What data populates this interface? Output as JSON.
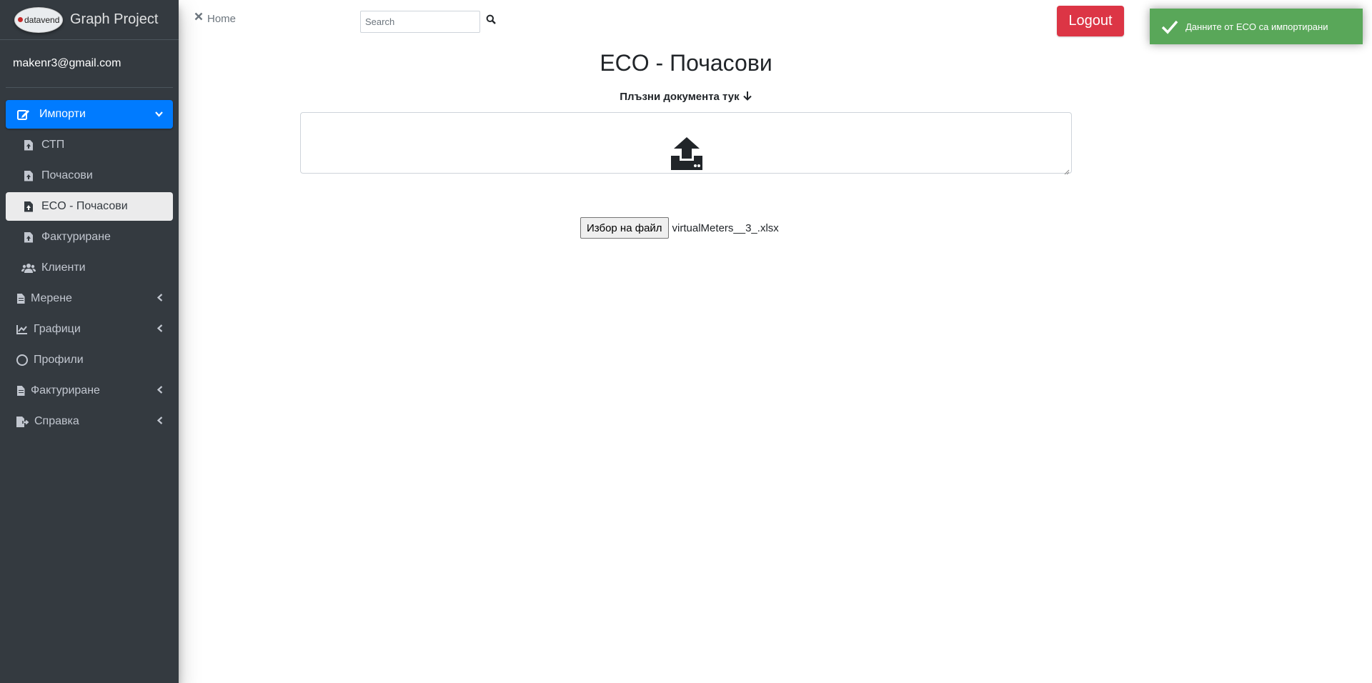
{
  "brand": {
    "logo_text": "datavend",
    "title": "Graph Project"
  },
  "user": {
    "email": "makenr3@gmail.com"
  },
  "sidebar": {
    "items": [
      {
        "label": "Импорти",
        "icon": "edit-icon",
        "state": "active",
        "expanded": true
      },
      {
        "label": "СТП",
        "icon": "file-upload-icon",
        "sub": true
      },
      {
        "label": "Почасови",
        "icon": "file-upload-icon",
        "sub": true
      },
      {
        "label": "ECO - Почасови",
        "icon": "file-upload-icon",
        "sub": true,
        "state": "selected"
      },
      {
        "label": "Фактуриране",
        "icon": "file-upload-icon",
        "sub": true
      },
      {
        "label": "Клиенти",
        "icon": "users-icon"
      },
      {
        "label": "Мерене",
        "icon": "file-text-icon",
        "has_children": true
      },
      {
        "label": "Графици",
        "icon": "chart-line-icon",
        "has_children": true
      },
      {
        "label": "Профили",
        "icon": "circle-icon"
      },
      {
        "label": "Фактуриране",
        "icon": "file-text-icon",
        "has_children": true
      },
      {
        "label": "Справка",
        "icon": "file-export-icon",
        "has_children": true
      }
    ]
  },
  "header": {
    "home_label": "Home",
    "search_placeholder": "Search",
    "logout_label": "Logout"
  },
  "toast": {
    "message": "Данните от ECO са импортирани",
    "color": "#51a351"
  },
  "main": {
    "title": "ECO - Почасови",
    "drop_label": "Плъзни документа тук",
    "file_button_label": "Избор на файл",
    "file_name": "virtualMeters__3_.xlsx"
  },
  "colors": {
    "sidebar": "#343a40",
    "active": "#007bff",
    "logout": "#dc3545"
  }
}
